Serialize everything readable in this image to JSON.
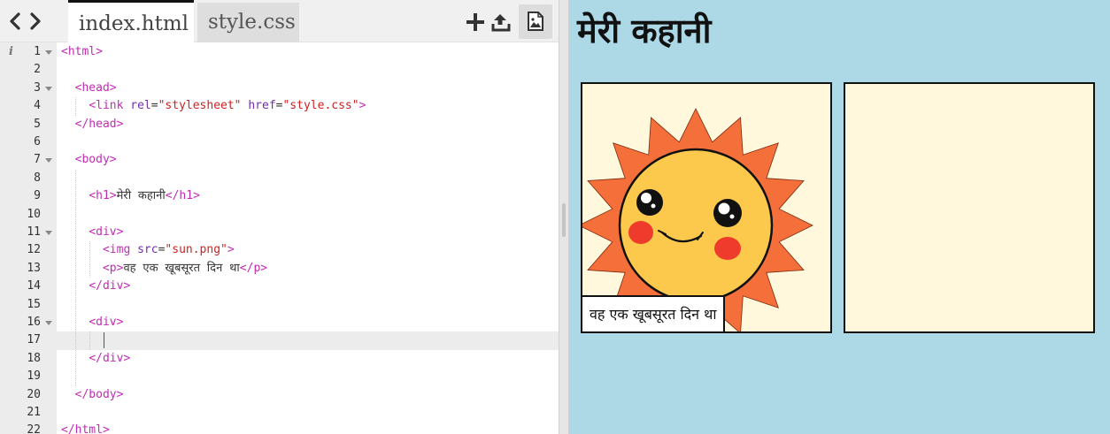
{
  "editor": {
    "tabs": [
      {
        "label": "index.html",
        "active": true
      },
      {
        "label": "style.css",
        "active": false
      }
    ],
    "toolbar": {
      "back_icon": "chevron-left-icon",
      "forward_icon": "chevron-right-icon",
      "add_icon": "plus-icon",
      "upload_icon": "upload-icon",
      "preview_icon": "image-icon"
    },
    "active_line": 17,
    "lines": [
      {
        "n": "1",
        "code": "<html>"
      },
      {
        "n": "2",
        "code": ""
      },
      {
        "n": "3",
        "code": "  <head>"
      },
      {
        "n": "4",
        "code": "    <link rel=\"stylesheet\" href=\"style.css\">"
      },
      {
        "n": "5",
        "code": "  </head>"
      },
      {
        "n": "6",
        "code": ""
      },
      {
        "n": "7",
        "code": "  <body>"
      },
      {
        "n": "8",
        "code": ""
      },
      {
        "n": "9",
        "code": "    <h1>मेरी कहानी</h1>"
      },
      {
        "n": "10",
        "code": ""
      },
      {
        "n": "11",
        "code": "    <div>"
      },
      {
        "n": "12",
        "code": "      <img src=\"sun.png\">"
      },
      {
        "n": "13",
        "code": "      <p>वह एक खूबसूरत दिन था</p>"
      },
      {
        "n": "14",
        "code": "    </div>"
      },
      {
        "n": "15",
        "code": ""
      },
      {
        "n": "16",
        "code": "    <div>"
      },
      {
        "n": "17",
        "code": ""
      },
      {
        "n": "18",
        "code": "    </div>"
      },
      {
        "n": "19",
        "code": ""
      },
      {
        "n": "20",
        "code": "  </body>"
      },
      {
        "n": "21",
        "code": ""
      },
      {
        "n": "22",
        "code": "</html>"
      }
    ]
  },
  "preview": {
    "title": "मेरी कहानी",
    "caption": "वह एक खूबसूरत दिन था",
    "background": "#add8e6",
    "panel_background": "#fff8dc"
  },
  "colors": {
    "tag": "#c22cb5",
    "attribute": "#6f2fb0",
    "string": "#cc2222"
  }
}
